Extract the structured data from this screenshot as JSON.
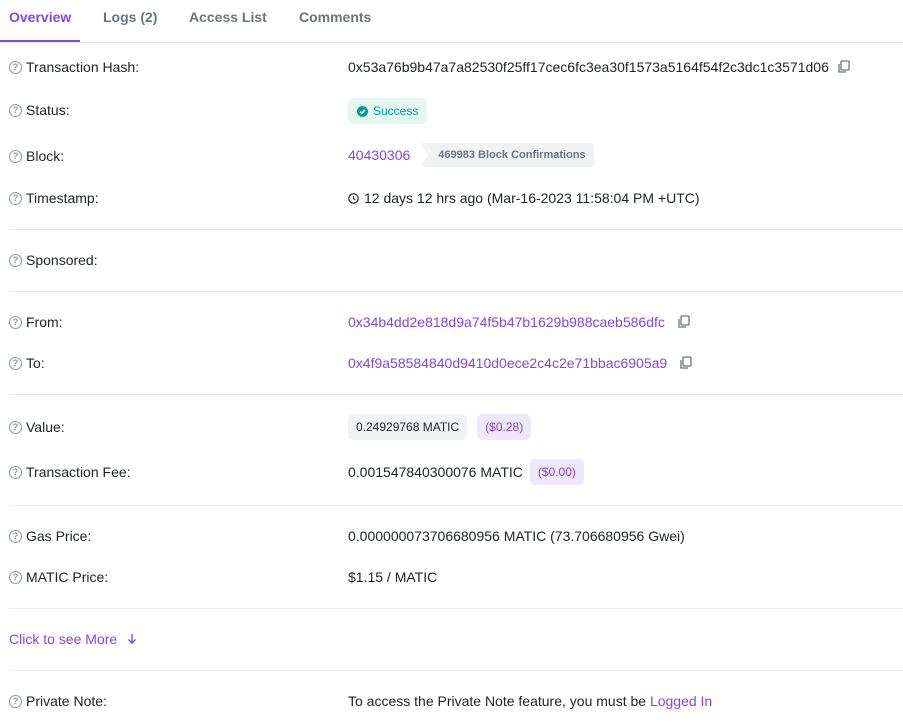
{
  "tabs": [
    {
      "label": "Overview"
    },
    {
      "label": "Logs (2)"
    },
    {
      "label": "Access List"
    },
    {
      "label": "Comments"
    }
  ],
  "rows": {
    "tx_hash": {
      "label": "Transaction Hash:",
      "value": "0x53a76b9b47a7a82530f25ff17cec6fc3ea30f1573a5164f54f2c3dc1c3571d06"
    },
    "status": {
      "label": "Status:",
      "value": "Success"
    },
    "block": {
      "label": "Block:",
      "value": "40430306",
      "confirmations": "469983 Block Confirmations"
    },
    "timestamp": {
      "label": "Timestamp:",
      "value": "12 days 12 hrs ago (Mar-16-2023 11:58:04 PM +UTC)"
    },
    "sponsored": {
      "label": "Sponsored:"
    },
    "from": {
      "label": "From:",
      "value": "0x34b4dd2e818d9a74f5b47b1629b988caeb586dfc"
    },
    "to": {
      "label": "To:",
      "value": "0x4f9a58584840d9410d0ece2c4c2e71bbac6905a9"
    },
    "value": {
      "label": "Value:",
      "amount": "0.24929768 MATIC",
      "usd": "($0.28)"
    },
    "fee": {
      "label": "Transaction Fee:",
      "amount": "0.001547840300076 MATIC",
      "usd": "($0.00)"
    },
    "gas_price": {
      "label": "Gas Price:",
      "value": "0.000000073706680956 MATIC (73.706680956 Gwei)"
    },
    "matic_price": {
      "label": "MATIC Price:",
      "value": "$1.15 / MATIC"
    },
    "more": {
      "label": "Click to see More"
    },
    "private_note": {
      "label": "Private Note:",
      "text": "To access the Private Note feature, you must be",
      "link": "Logged In"
    }
  },
  "colors": {
    "accent": "#8247e5",
    "success": "#00a186"
  }
}
